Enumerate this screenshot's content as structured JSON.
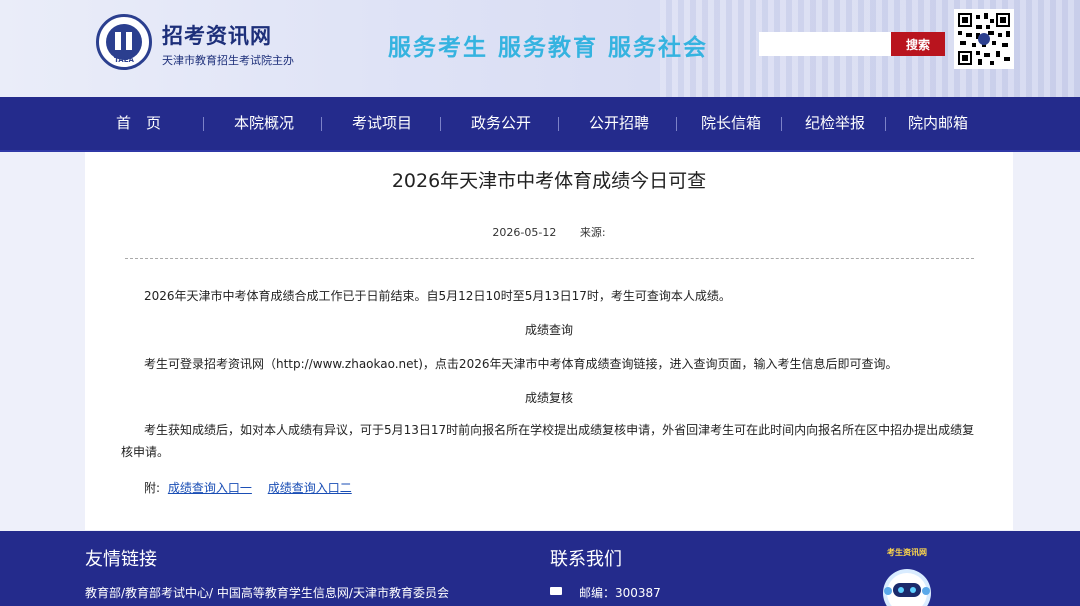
{
  "header": {
    "logo_text": "TAEA",
    "site_name": "招考资讯网",
    "site_sub": "天津市教育招生考试院主办",
    "slogan": "服务考生  服务教育  服务社会",
    "search": {
      "value": "",
      "placeholder": "",
      "button_label": "搜索"
    }
  },
  "nav": {
    "items": [
      {
        "label": "首　页"
      },
      {
        "label": "本院概况"
      },
      {
        "label": "考试项目"
      },
      {
        "label": "政务公开"
      },
      {
        "label": "公开招聘"
      },
      {
        "label": "院长信箱"
      },
      {
        "label": "纪检举报"
      },
      {
        "label": "院内邮箱"
      }
    ]
  },
  "article": {
    "title": "2026年天津市中考体育成绩今日可查",
    "date": "2026-05-12",
    "source_label": "来源:",
    "paragraphs": [
      "2026年天津市中考体育成绩合成工作已于日前结束。自5月12日10时至5月13日17时，考生可查询本人成绩。",
      "成绩查询",
      "考生可登录招考资讯网（http://www.zhaokao.net)，点击2026年天津市中考体育成绩查询链接，进入查询页面，输入考生信息后即可查询。",
      "成绩复核",
      "考生获知成绩后，如对本人成绩有异议，可于5月13日17时前向报名所在学校提出成绩复核申请，外省回津考生可在此时间内向报名所在区中招办提出成绩复核申请。"
    ],
    "attach_label": "附:",
    "links": [
      {
        "label": "成绩查询入口一"
      },
      {
        "label": "成绩查询入口二"
      }
    ]
  },
  "footer": {
    "links_heading": "友情链接",
    "links_text": "教育部/教育部考试中心/ 中国高等教育学生信息网/天津市教育委员会",
    "contact_heading": "联系我们",
    "postcode": "邮编：300387",
    "mascot_text": "考生资讯网"
  },
  "colors": {
    "nav_bg": "#242b8c",
    "search_button": "#b9141e",
    "slogan": "#35b3e0",
    "link": "#1a4eb5"
  }
}
